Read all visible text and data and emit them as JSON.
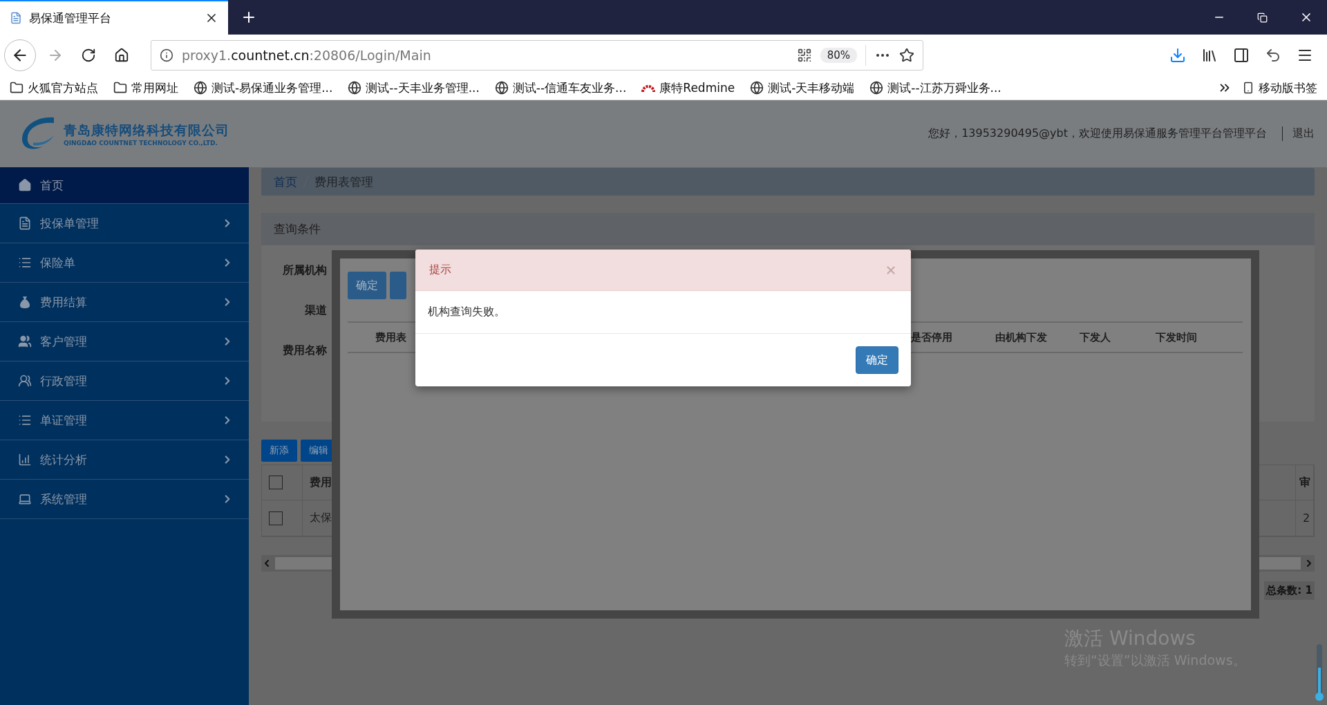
{
  "browser": {
    "tab": {
      "title": "易保通管理平台"
    },
    "url": "proxy1.**countnet.cn**:20806/Login/Main",
    "zoom": "80%",
    "bookmarks": [
      {
        "label": "火狐官方站点",
        "kind": "folder"
      },
      {
        "label": "常用网址",
        "kind": "folder"
      },
      {
        "label": "测试-易保通业务管理...",
        "kind": "site"
      },
      {
        "label": "测试--天丰业务管理...",
        "kind": "site"
      },
      {
        "label": "测试--信通车友业务...",
        "kind": "site"
      },
      {
        "label": "康特Redmine",
        "kind": "redmine"
      },
      {
        "label": "测试-天丰移动端",
        "kind": "site"
      },
      {
        "label": "测试--江苏万舜业务...",
        "kind": "site"
      }
    ],
    "mobile_bookmarks": "移动版书签"
  },
  "header": {
    "company_cn": "青岛康特网络科技有限公司",
    "company_en": "QINGDAO COUNTNET TECHNOLOGY CO.,LTD.",
    "greeting": "您好，13953290495@ybt，欢迎使用易保通服务管理平台管理平台",
    "logout": "退出"
  },
  "sidebar": {
    "items": [
      {
        "label": "首页",
        "kind": "home",
        "selected": true
      },
      {
        "label": "投保单管理",
        "kind": "file",
        "selected": false
      },
      {
        "label": "保险单",
        "kind": "list",
        "selected": false
      },
      {
        "label": "费用结算",
        "kind": "money",
        "selected": false
      },
      {
        "label": "客户管理",
        "kind": "user",
        "selected": false
      },
      {
        "label": "行政管理",
        "kind": "group",
        "selected": false
      },
      {
        "label": "单证管理",
        "kind": "list",
        "selected": false
      },
      {
        "label": "统计分析",
        "kind": "chart",
        "selected": false
      },
      {
        "label": "系统管理",
        "kind": "laptop",
        "selected": false
      }
    ]
  },
  "breadcrumb": [
    "首页",
    "费用表管理"
  ],
  "query": {
    "title": "查询条件",
    "labels": [
      "所属机构",
      "渠道",
      "费用名称"
    ]
  },
  "toolbar": [
    "新添",
    "编辑"
  ],
  "table": {
    "header_checked": false,
    "columns": [
      "费用",
      "审"
    ],
    "rows": [
      {
        "checked": false,
        "cells": [
          "太保",
          "2"
        ]
      }
    ]
  },
  "total": "总条数: 1",
  "layer": {
    "buttons": [
      "确定"
    ],
    "columns": [
      "费用表",
      "是否停用",
      "由机构下发",
      "下发人",
      "下发时间"
    ]
  },
  "alert": {
    "title": "提示",
    "message": "机构查询失败。",
    "ok": "确定"
  },
  "activation": {
    "title": "激活 Windows",
    "subtitle": "转到“设置”以激活 Windows。"
  }
}
